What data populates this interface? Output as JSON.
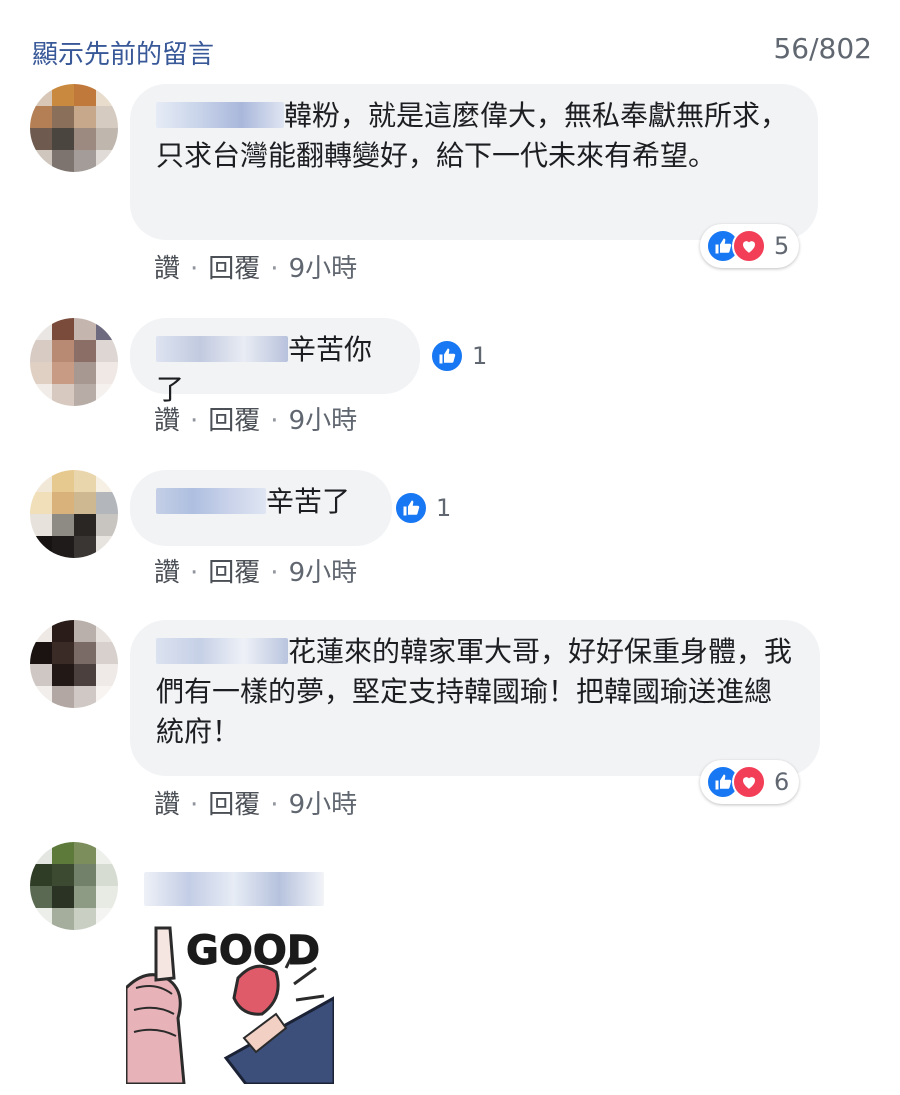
{
  "header": {
    "prev_comments": "顯示先前的留言",
    "counter": "56/802"
  },
  "action_labels": {
    "like": "讚",
    "reply": "回覆",
    "separator": "·"
  },
  "comments": [
    {
      "text": "韓粉，就是這麼偉大，無私奉獻無所求，只求台灣能翻轉變好，給下一代未來有希望。",
      "time": "9小時",
      "reaction_count": "5"
    },
    {
      "text": "辛苦你了",
      "time": "9小時",
      "reaction_count": "1"
    },
    {
      "text": "辛苦了",
      "time": "9小時",
      "reaction_count": "1"
    },
    {
      "text": "花蓮來的韓家軍大哥，好好保重身體，我們有一樣的夢，堅定支持韓國瑜！把韓國瑜送進總統府！",
      "time": "9小時",
      "reaction_count": "6"
    },
    {
      "text": "",
      "time": "",
      "reaction_count": ""
    }
  ],
  "sticker": {
    "text": "GOOD"
  },
  "colors": {
    "link": "#385898",
    "like": "#1877f2",
    "love": "#f33e58",
    "bubble": "#f2f3f5"
  }
}
